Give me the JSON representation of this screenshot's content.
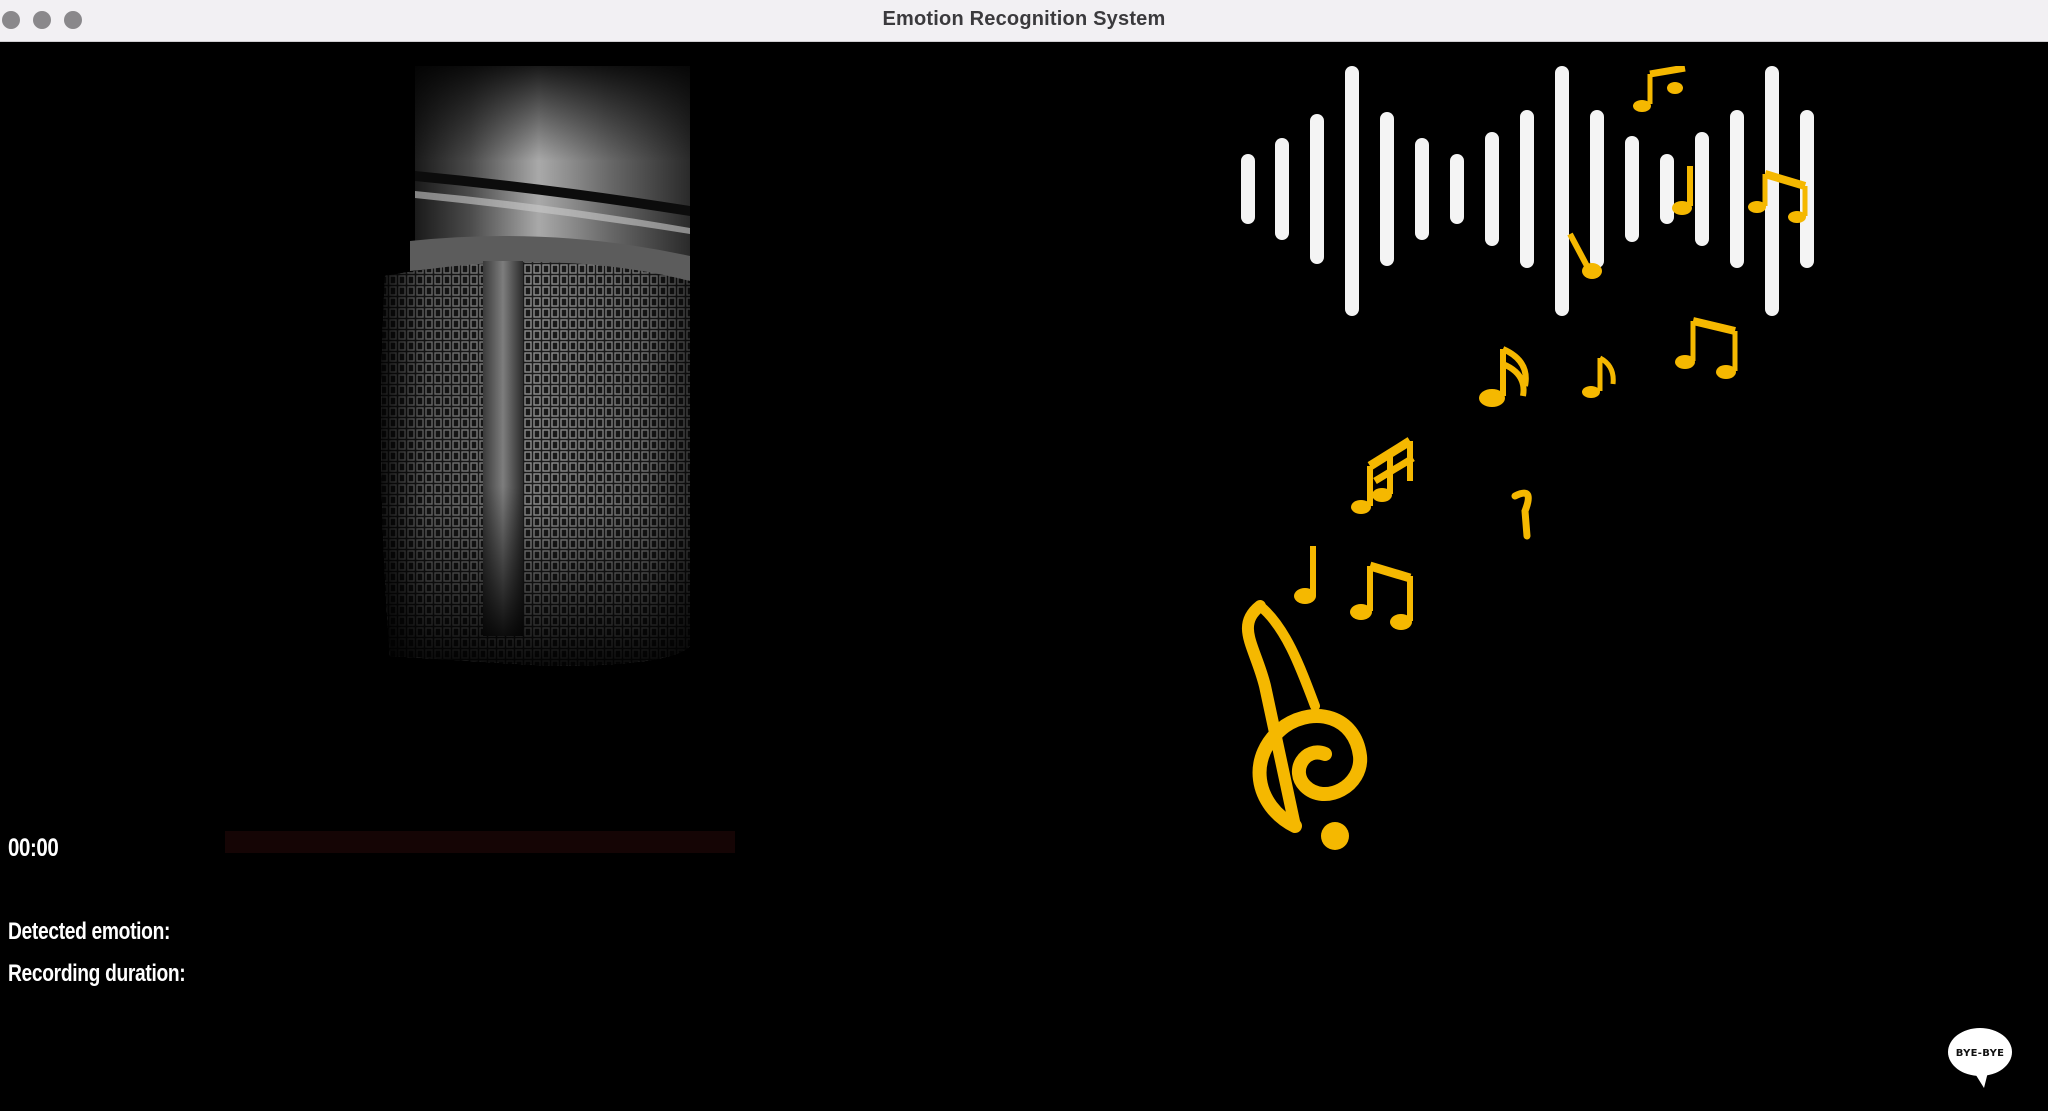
{
  "window": {
    "title": "Emotion Recognition System"
  },
  "recorder": {
    "timer": "00:00",
    "detected_emotion_label": "Detected emotion:",
    "recording_duration_label": "Recording duration:"
  },
  "bye_button": {
    "label": "BYE-BYE"
  },
  "colors": {
    "background": "#000000",
    "titlebar": "#f2f0f3",
    "text": "#ffffff",
    "accent_notes": "#f5b800",
    "waveform": "#f4f4f4"
  },
  "icons": {
    "microphone": "microphone-image",
    "music": "music-notes-waveform-image",
    "bye": "speech-bubble-icon"
  }
}
